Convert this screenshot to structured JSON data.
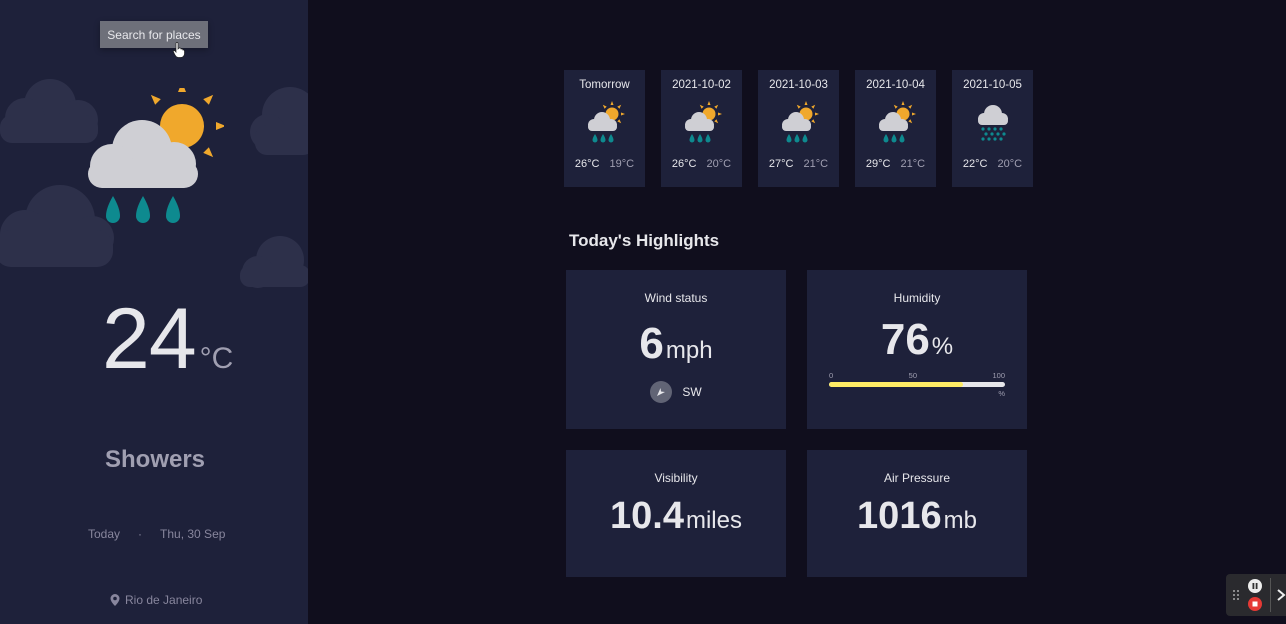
{
  "sidebar": {
    "search_label": "Search for places",
    "main_icon": "sun-cloud-rain-icon",
    "temperature": "24",
    "temperature_unit": "°C",
    "condition": "Showers",
    "date_label": "Today",
    "separator": "·",
    "date": "Thu, 30 Sep",
    "location": "Rio de Janeiro",
    "location_icon": "location-pin-icon"
  },
  "forecast": [
    {
      "day": "Tomorrow",
      "icon": "sun-cloud-rain-icon",
      "max": "26°C",
      "min": "19°C"
    },
    {
      "day": "2021-10-02",
      "icon": "sun-cloud-rain-icon",
      "max": "26°C",
      "min": "20°C"
    },
    {
      "day": "2021-10-03",
      "icon": "sun-cloud-rain-icon",
      "max": "27°C",
      "min": "21°C"
    },
    {
      "day": "2021-10-04",
      "icon": "sun-cloud-rain-icon",
      "max": "29°C",
      "min": "21°C"
    },
    {
      "day": "2021-10-05",
      "icon": "heavy-rain-icon",
      "max": "22°C",
      "min": "20°C"
    }
  ],
  "highlights": {
    "title": "Today's Highlights",
    "wind": {
      "title": "Wind status",
      "value": "6",
      "unit": "mph",
      "direction": "SW",
      "icon": "wind-direction-icon"
    },
    "humidity": {
      "title": "Humidity",
      "value": "76",
      "unit": "%",
      "scale_min": "0",
      "scale_mid": "50",
      "scale_max": "100",
      "scale_unit": "%",
      "percent": 76
    },
    "visibility": {
      "title": "Visibility",
      "value": "10.4",
      "unit": "miles"
    },
    "pressure": {
      "title": "Air Pressure",
      "value": "1016",
      "unit": "mb"
    }
  },
  "colors": {
    "background": "#100e1d",
    "sidebar": "#1e213a",
    "card": "#1e213a",
    "humidity_bar": "#ffec65",
    "button": "#6e707a"
  },
  "recorder": {
    "pause_icon": "pause-icon",
    "stop_icon": "stop-icon",
    "collapse_icon": "chevron-right-icon",
    "drag_icon": "drag-handle-icon"
  }
}
